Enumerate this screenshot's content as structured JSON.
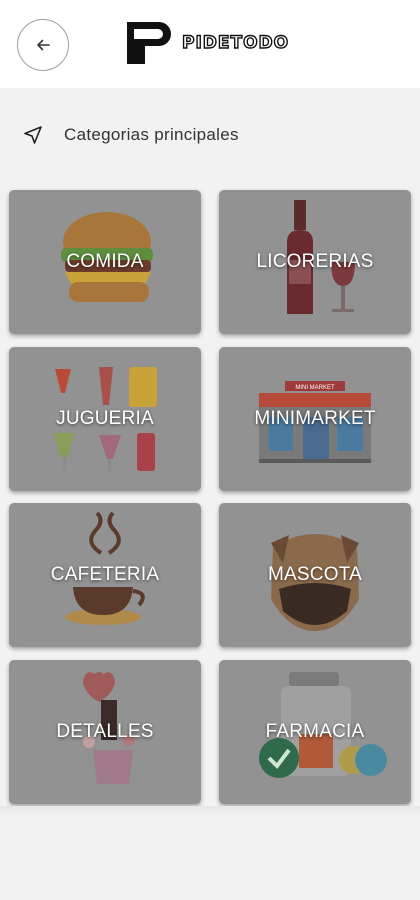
{
  "header": {
    "back_icon": "arrow-left-icon",
    "logo_text": "PIDETODO"
  },
  "section": {
    "icon": "navigation-arrow-icon",
    "title": "Categorias principales"
  },
  "categories": [
    {
      "label": "COMIDA",
      "icon": "burger-icon"
    },
    {
      "label": "LICORERIAS",
      "icon": "wine-bottle-icon"
    },
    {
      "label": "JUGUERIA",
      "icon": "juice-glasses-icon"
    },
    {
      "label": "MINIMARKET",
      "icon": "storefront-icon"
    },
    {
      "label": "CAFETERIA",
      "icon": "coffee-cup-icon"
    },
    {
      "label": "MASCOTA",
      "icon": "dog-icon"
    },
    {
      "label": "DETALLES",
      "icon": "gift-balloon-icon"
    },
    {
      "label": "FARMACIA",
      "icon": "pharmacy-icon"
    }
  ],
  "minimarket_sign": "MINI MARKET",
  "colors": {
    "card_overlay": "#929292",
    "background": "#f2f2f2",
    "header": "#ffffff"
  }
}
